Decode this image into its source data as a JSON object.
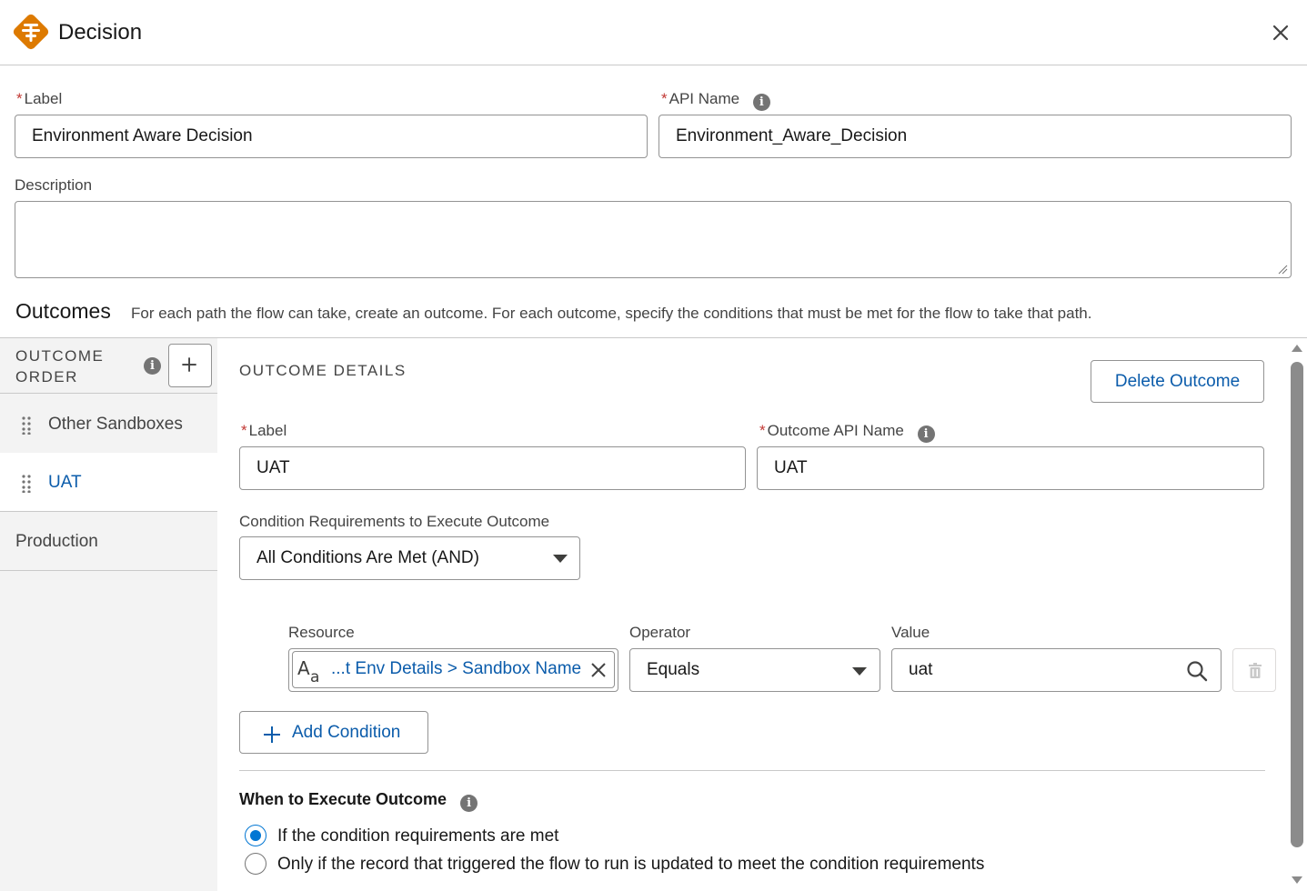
{
  "header": {
    "title": "Decision",
    "icon": "decision-icon",
    "close_icon": "close-icon"
  },
  "form": {
    "label": {
      "caption": "Label",
      "required": "*",
      "value": "Environment Aware Decision"
    },
    "api_name": {
      "caption": "API Name",
      "required": "*",
      "value": "Environment_Aware_Decision",
      "icon": "info-icon"
    },
    "description": {
      "caption": "Description",
      "value": ""
    }
  },
  "outcomes": {
    "title": "Outcomes",
    "description": "For each path the flow can take, create an outcome. For each outcome, specify the conditions that must be met for the flow to take that path."
  },
  "sidebar": {
    "heading": "OUTCOME ORDER",
    "items": [
      {
        "label": "Other Sandboxes",
        "draggable": true,
        "selected": false
      },
      {
        "label": "UAT",
        "draggable": true,
        "selected": true
      },
      {
        "label": "Production",
        "draggable": false,
        "selected": false
      }
    ]
  },
  "details": {
    "heading": "OUTCOME DETAILS",
    "delete_label": "Delete Outcome",
    "label": {
      "caption": "Label",
      "required": "*",
      "value": "UAT"
    },
    "api_name": {
      "caption": "Outcome API Name",
      "required": "*",
      "value": "UAT"
    },
    "condition_requirements": {
      "caption": "Condition Requirements to Execute Outcome",
      "value": "All Conditions Are Met (AND)"
    },
    "condition": {
      "resource_caption": "Resource",
      "resource_value": "...t Env Details > Sandbox Name",
      "operator_caption": "Operator",
      "operator_value": "Equals",
      "value_caption": "Value",
      "value": "uat"
    },
    "add_condition_label": "Add Condition",
    "when_title": "When to Execute Outcome",
    "when_options": [
      {
        "label": "If the condition requirements are met",
        "checked": true
      },
      {
        "label": "Only if the record that triggered the flow to run is updated to meet the condition requirements",
        "checked": false
      }
    ]
  },
  "colors": {
    "brand_orange": "#dd7a01",
    "link_blue": "#0b5cab",
    "radio_blue": "#0176d3",
    "required_red": "#c23934"
  }
}
